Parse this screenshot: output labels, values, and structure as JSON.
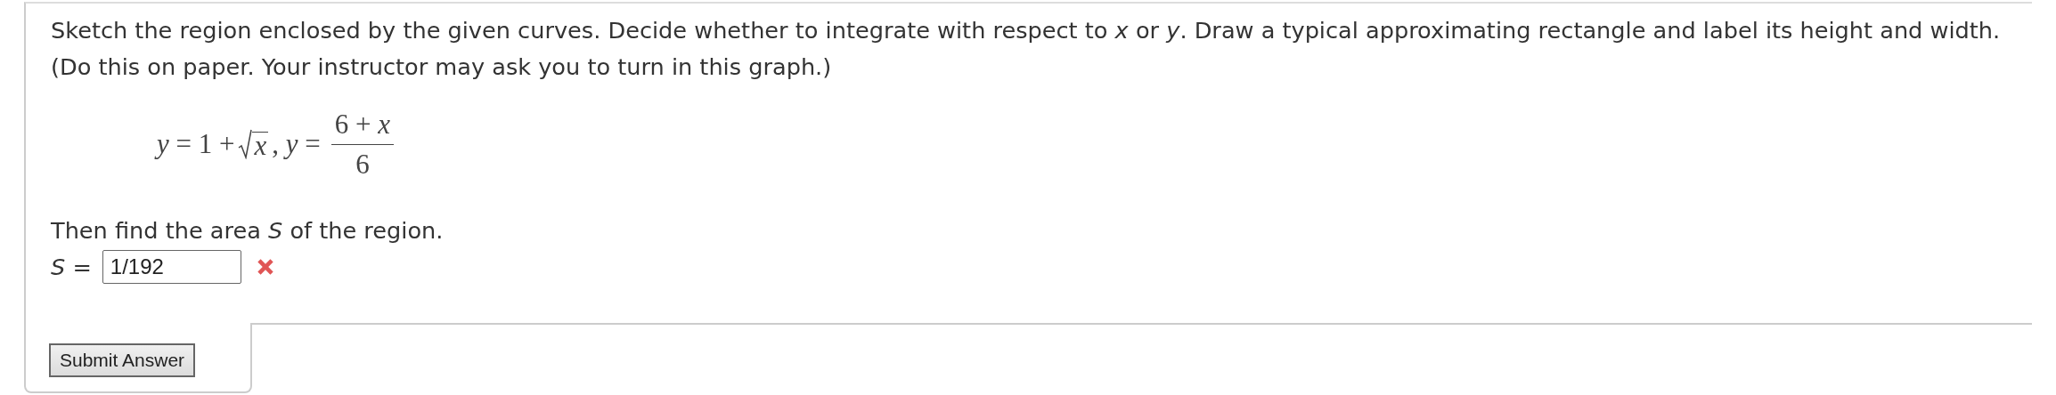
{
  "question": {
    "instructions": "Sketch the region enclosed by the given curves. Decide whether to integrate with respect to *x* or *y*. Draw a typical approximating rectangle and label its height and width.",
    "note": "(Do this on paper. Your instructor may ask you to turn in this graph.)",
    "formula": {
      "lead": "*y* = 1 +",
      "radicand": "x",
      "middle": ", *y* =",
      "numerator": "6 + *x*",
      "denominator": "6"
    },
    "prompt": "Then find the area *S* of the region.",
    "answer": {
      "label": "*S* =",
      "value": "1/192",
      "correct": false
    }
  },
  "submit_button": "Submit Answer"
}
